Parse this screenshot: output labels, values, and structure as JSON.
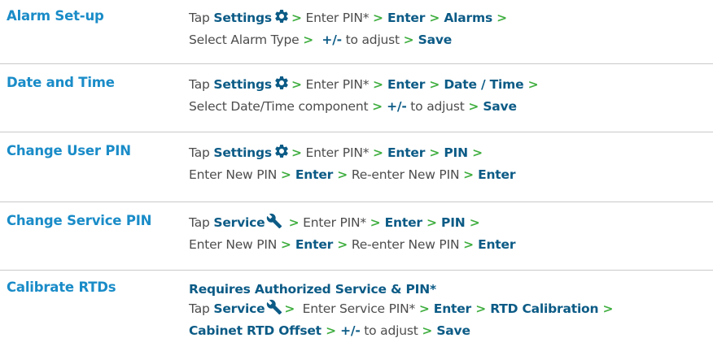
{
  "rows": [
    {
      "title": "Alarm Set-up",
      "lines": [
        [
          {
            "t": "n",
            "v": "Tap "
          },
          {
            "t": "k",
            "v": "Settings"
          },
          {
            "t": "icon",
            "v": "gear-icon"
          },
          {
            "t": "a",
            "v": ">"
          },
          {
            "t": "n",
            "v": " Enter PIN* "
          },
          {
            "t": "a",
            "v": ">"
          },
          {
            "t": "k",
            "v": " Enter "
          },
          {
            "t": "a",
            "v": ">"
          },
          {
            "t": "k",
            "v": " Alarms "
          },
          {
            "t": "a",
            "v": ">"
          }
        ],
        [
          {
            "t": "n",
            "v": "Select Alarm Type "
          },
          {
            "t": "a",
            "v": ">"
          },
          {
            "t": "k",
            "v": "  +/-"
          },
          {
            "t": "n",
            "v": " to adjust "
          },
          {
            "t": "a",
            "v": ">"
          },
          {
            "t": "k",
            "v": " Save"
          }
        ]
      ]
    },
    {
      "title": "Date and Time",
      "lines": [
        [
          {
            "t": "n",
            "v": "Tap "
          },
          {
            "t": "k",
            "v": "Settings"
          },
          {
            "t": "icon",
            "v": "gear-icon"
          },
          {
            "t": "a",
            "v": ">"
          },
          {
            "t": "n",
            "v": " Enter PIN* "
          },
          {
            "t": "a",
            "v": ">"
          },
          {
            "t": "k",
            "v": " Enter "
          },
          {
            "t": "a",
            "v": ">"
          },
          {
            "t": "k",
            "v": " Date / Time "
          },
          {
            "t": "a",
            "v": ">"
          }
        ],
        [
          {
            "t": "n",
            "v": "Select Date/Time component "
          },
          {
            "t": "a",
            "v": ">"
          },
          {
            "t": "k",
            "v": " +/-"
          },
          {
            "t": "n",
            "v": " to adjust "
          },
          {
            "t": "a",
            "v": ">"
          },
          {
            "t": "k",
            "v": " Save"
          }
        ]
      ]
    },
    {
      "title": "Change User PIN",
      "lines": [
        [
          {
            "t": "n",
            "v": "Tap "
          },
          {
            "t": "k",
            "v": "Settings"
          },
          {
            "t": "icon",
            "v": "gear-icon"
          },
          {
            "t": "a",
            "v": ">"
          },
          {
            "t": "n",
            "v": " Enter PIN* "
          },
          {
            "t": "a",
            "v": ">"
          },
          {
            "t": "k",
            "v": " Enter "
          },
          {
            "t": "a",
            "v": ">"
          },
          {
            "t": "k",
            "v": " PIN "
          },
          {
            "t": "a",
            "v": ">"
          }
        ],
        [
          {
            "t": "n",
            "v": "Enter New PIN "
          },
          {
            "t": "a",
            "v": ">"
          },
          {
            "t": "k",
            "v": " Enter "
          },
          {
            "t": "a",
            "v": ">"
          },
          {
            "t": "n",
            "v": " Re-enter New PIN "
          },
          {
            "t": "a",
            "v": ">"
          },
          {
            "t": "k",
            "v": " Enter"
          }
        ]
      ]
    },
    {
      "title": "Change Service PIN",
      "lines": [
        [
          {
            "t": "n",
            "v": "Tap "
          },
          {
            "t": "k",
            "v": "Service"
          },
          {
            "t": "icon",
            "v": "wrench-icon"
          },
          {
            "t": "a",
            "v": " >"
          },
          {
            "t": "n",
            "v": " Enter PIN* "
          },
          {
            "t": "a",
            "v": ">"
          },
          {
            "t": "k",
            "v": " Enter "
          },
          {
            "t": "a",
            "v": ">"
          },
          {
            "t": "k",
            "v": " PIN "
          },
          {
            "t": "a",
            "v": ">"
          }
        ],
        [
          {
            "t": "n",
            "v": "Enter New PIN "
          },
          {
            "t": "a",
            "v": ">"
          },
          {
            "t": "k",
            "v": " Enter "
          },
          {
            "t": "a",
            "v": ">"
          },
          {
            "t": "n",
            "v": " Re-enter New PIN "
          },
          {
            "t": "a",
            "v": ">"
          },
          {
            "t": "k",
            "v": " Enter"
          }
        ]
      ]
    },
    {
      "title": "Calibrate RTDs",
      "lines": [
        [
          {
            "t": "b",
            "v": "Requires Authorized Service & PIN*"
          }
        ],
        [
          {
            "t": "n",
            "v": "Tap "
          },
          {
            "t": "k",
            "v": "Service"
          },
          {
            "t": "icon",
            "v": "wrench-icon"
          },
          {
            "t": "a",
            "v": ">"
          },
          {
            "t": "n",
            "v": "  Enter Service PIN* "
          },
          {
            "t": "a",
            "v": ">"
          },
          {
            "t": "k",
            "v": " Enter "
          },
          {
            "t": "a",
            "v": ">"
          },
          {
            "t": "k",
            "v": " RTD Calibration "
          },
          {
            "t": "a",
            "v": ">"
          }
        ],
        [
          {
            "t": "k",
            "v": "Cabinet RTD Offset "
          },
          {
            "t": "a",
            "v": ">"
          },
          {
            "t": "k",
            "v": " +/-"
          },
          {
            "t": "n",
            "v": " to adjust "
          },
          {
            "t": "a",
            "v": ">"
          },
          {
            "t": "k",
            "v": " Save"
          }
        ]
      ]
    }
  ],
  "colors": {
    "title": "#1a8cc8",
    "keyword": "#0c5b86",
    "arrow": "#3fae3f",
    "text": "#4d4d4d",
    "separator": "#c9c9c9"
  }
}
